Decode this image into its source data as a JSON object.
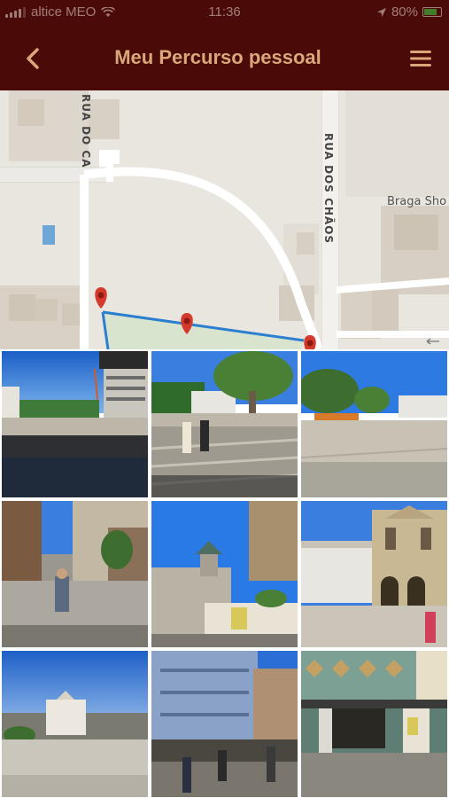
{
  "status_bar": {
    "carrier": "altice MEO",
    "time": "11:36",
    "battery": "80%",
    "battery_level": 0.8,
    "icons": [
      "signal-icon",
      "wifi-icon",
      "location-arrow-icon",
      "battery-icon"
    ]
  },
  "header": {
    "title": "Meu Percurso pessoal",
    "back_icon": "chevron-left-icon",
    "menu_icon": "hamburger-menu-icon"
  },
  "map": {
    "streets": [
      "RUA DO CA",
      "RUA DOS CHÃOS"
    ],
    "poi": "Braga Sho",
    "markers": 3,
    "marker_color": "#d33a2c",
    "route_color": "#2a7fd1"
  },
  "photos": [
    {
      "name": "photo-1",
      "scene": "square-building-scaffolding"
    },
    {
      "name": "photo-2",
      "scene": "square-tree-people"
    },
    {
      "name": "photo-3",
      "scene": "square-trees-buildings"
    },
    {
      "name": "photo-4",
      "scene": "street-person-walking"
    },
    {
      "name": "photo-5",
      "scene": "church-tower-kiosk"
    },
    {
      "name": "photo-6",
      "scene": "historic-facade"
    },
    {
      "name": "photo-7",
      "scene": "plaza-white-building"
    },
    {
      "name": "photo-8",
      "scene": "tiled-building-crowd"
    },
    {
      "name": "photo-9",
      "scene": "green-tiled-storefront"
    }
  ],
  "colors": {
    "header_bg": "#4a0a08",
    "title_color": "#d9a779",
    "map_bg": "#ebe8e1"
  }
}
